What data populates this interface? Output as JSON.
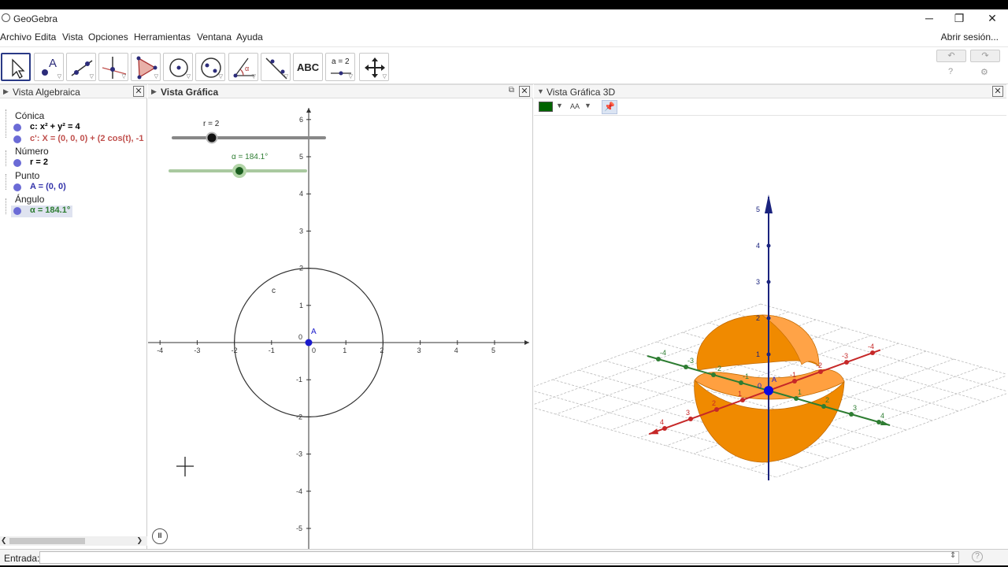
{
  "window": {
    "title": "GeoGebra",
    "min_glyph": "─",
    "max_glyph": "❐",
    "close_glyph": "✕"
  },
  "menu": {
    "items": [
      "Archivo",
      "Edita",
      "Vista",
      "Opciones",
      "Herramientas",
      "Ventana",
      "Ayuda"
    ],
    "signin": "Abrir sesión..."
  },
  "toolbar": {
    "tools": [
      {
        "name": "move-tool",
        "label": ""
      },
      {
        "name": "point-tool",
        "label": "A"
      },
      {
        "name": "line-tool",
        "label": ""
      },
      {
        "name": "perpendicular-tool",
        "label": ""
      },
      {
        "name": "polygon-tool",
        "label": ""
      },
      {
        "name": "circle-tool",
        "label": ""
      },
      {
        "name": "conic-tool",
        "label": ""
      },
      {
        "name": "angle-tool",
        "label": "α"
      },
      {
        "name": "reflect-tool",
        "label": ""
      },
      {
        "name": "text-tool",
        "label": "ABC"
      },
      {
        "name": "slider-tool",
        "label": "a = 2"
      },
      {
        "name": "move-view-tool",
        "label": ""
      }
    ],
    "undo": "↶",
    "redo": "↷",
    "help": "?",
    "settings": "⚙"
  },
  "algebra": {
    "title": "Vista Algebraica",
    "categories": [
      "Cónica",
      "Número",
      "Punto",
      "Ángulo"
    ],
    "rows": [
      {
        "text": "c: x² + y² = 4",
        "color": "#000000"
      },
      {
        "text": "c': X = (0, 0, 0) + (2 cos(t), -1",
        "color": "#c0504d"
      },
      {
        "text": "r = 2",
        "color": "#000000"
      },
      {
        "text": "A = (0, 0)",
        "color": "#3333aa"
      },
      {
        "text": "α = 184.1°",
        "color": "#2e7d32"
      }
    ]
  },
  "graphics": {
    "title": "Vista Gráfica",
    "slider_r_label": "r = 2",
    "slider_alpha_label": "α = 184.1°",
    "circle_label": "c",
    "point_label": "A",
    "x_ticks": [
      "-4",
      "-3",
      "-2",
      "-1",
      "0",
      "1",
      "2",
      "3",
      "4",
      "5"
    ],
    "y_ticks": [
      "6",
      "5",
      "4",
      "3",
      "2",
      "1",
      "0",
      "-1",
      "-2",
      "-3",
      "-4",
      "-5"
    ],
    "pause": "II"
  },
  "g3d": {
    "title": "Vista Gráfica 3D",
    "font_label": "AA",
    "color_swatch": "#006400",
    "surface_color": "#f08a00",
    "z_ticks": [
      "5",
      "4",
      "3",
      "2",
      "1"
    ],
    "x_ticks": [
      "4",
      "3",
      "2",
      "1",
      "-1",
      "-2",
      "-3",
      "-4"
    ],
    "y_ticks": [
      "-4",
      "-3",
      "-2",
      "-1",
      "1",
      "2",
      "3",
      "4"
    ],
    "origin_label": "0",
    "point_label": "A"
  },
  "inputbar": {
    "label": "Entrada:",
    "value": "",
    "help": "?"
  }
}
